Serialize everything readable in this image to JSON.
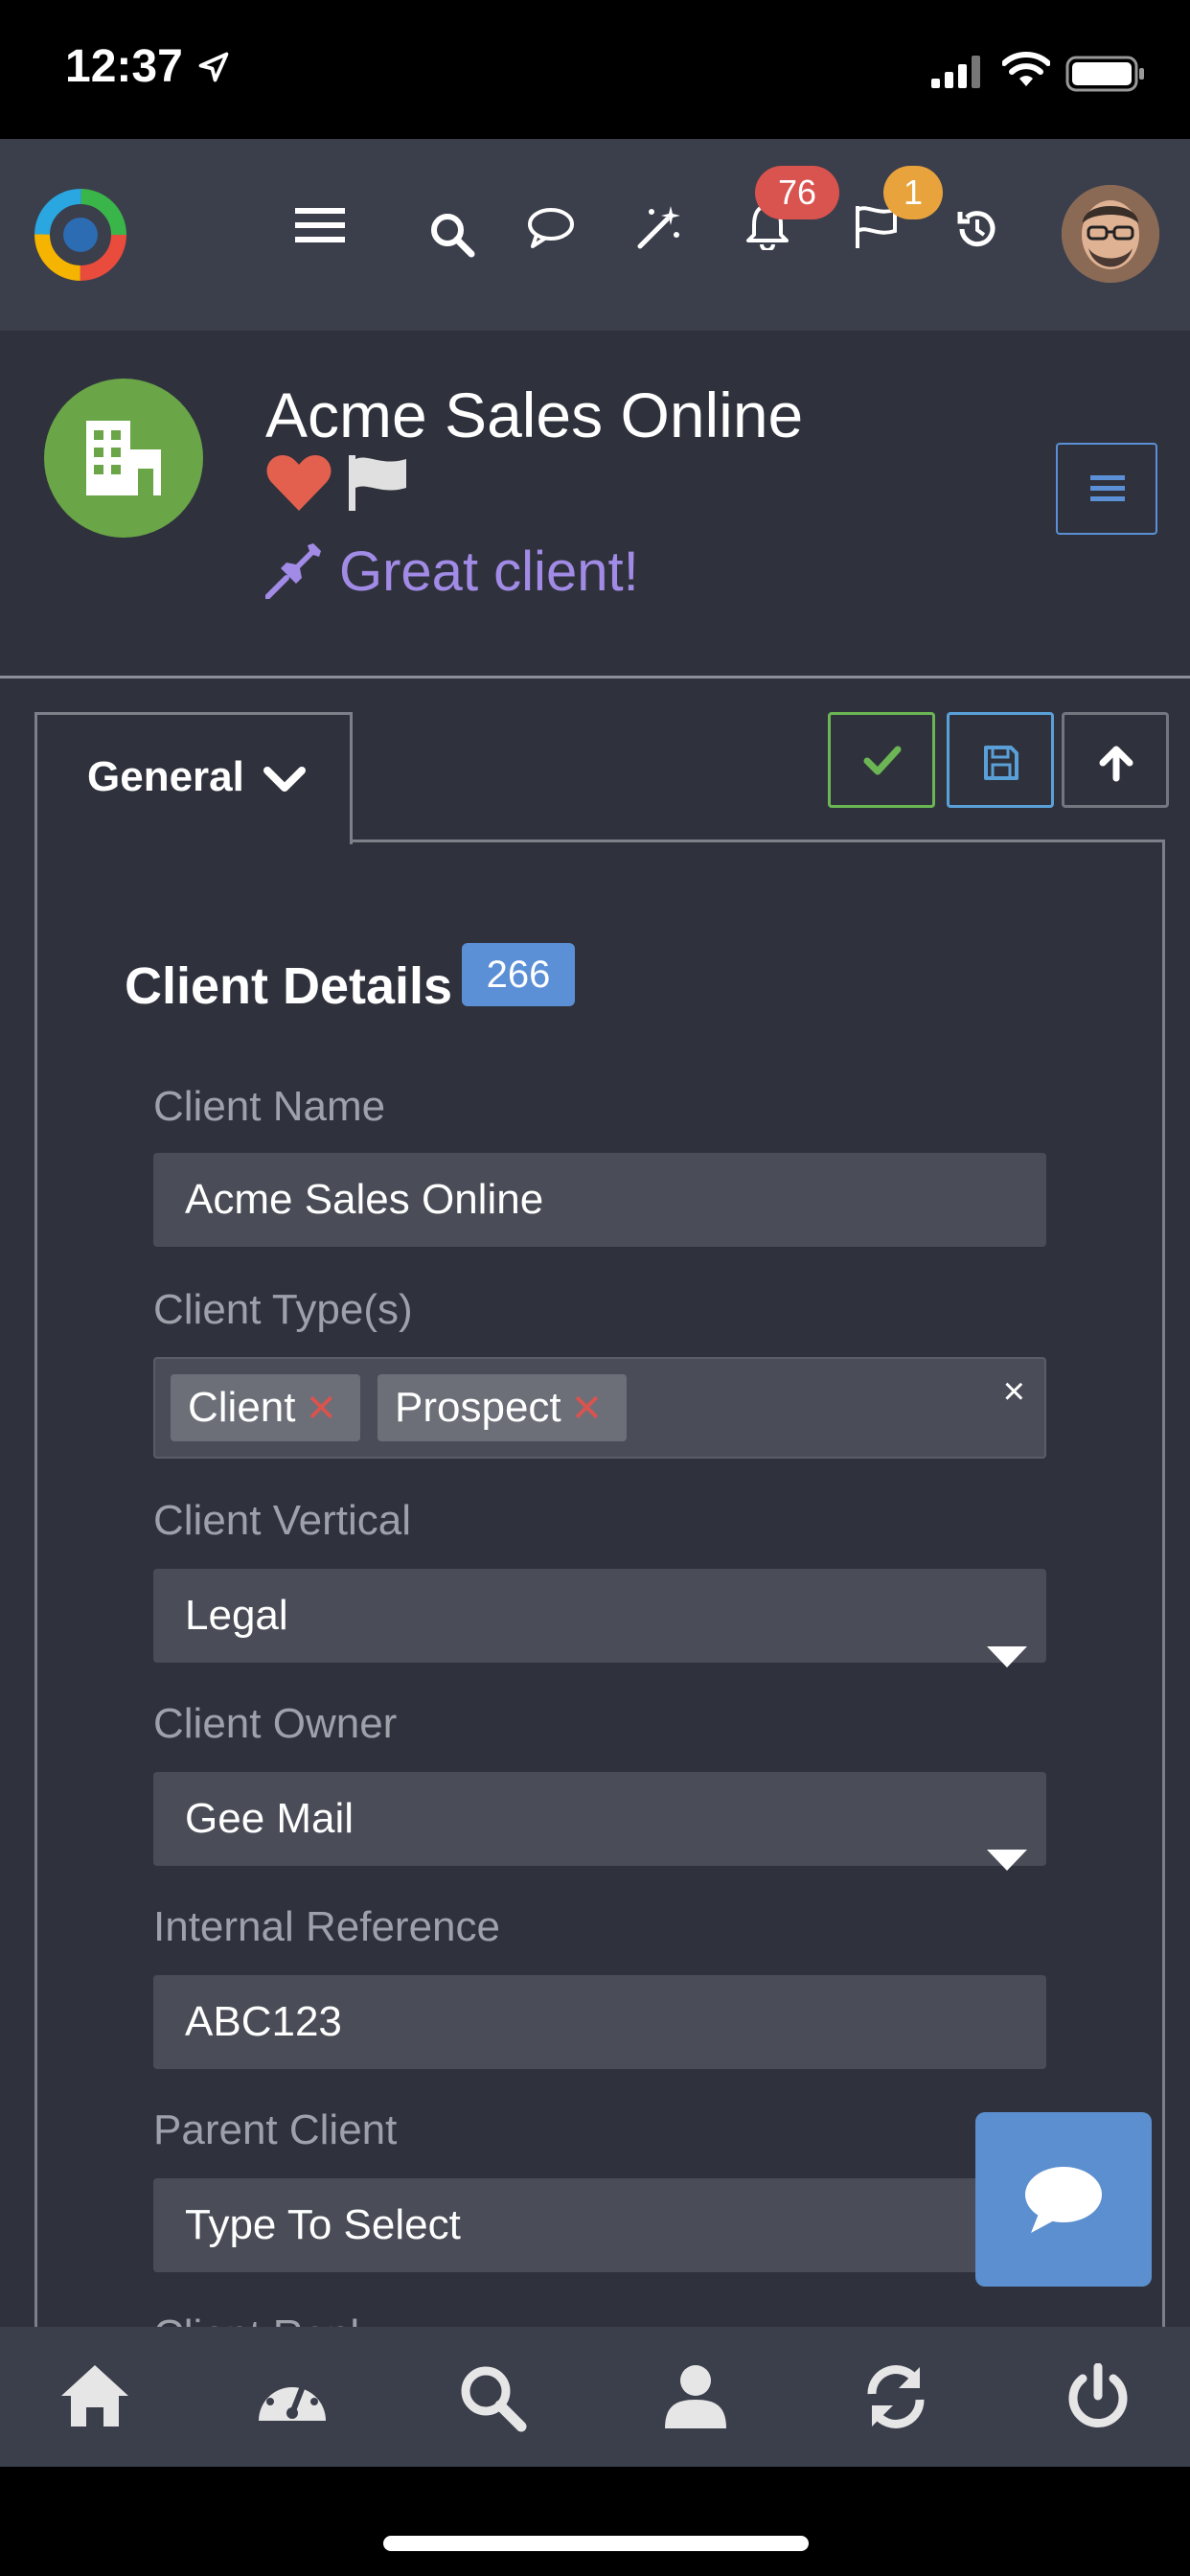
{
  "status_bar": {
    "time": "12:37"
  },
  "navbar": {
    "notifications_count": "76",
    "flags_count": "1"
  },
  "client": {
    "name": "Acme Sales Online",
    "pinned_note": "Great client!"
  },
  "tabs": {
    "active": "General"
  },
  "section": {
    "title": "Client Details",
    "count": "266"
  },
  "fields": {
    "client_name": {
      "label": "Client Name",
      "value": "Acme Sales Online"
    },
    "client_types": {
      "label": "Client Type(s)",
      "tags": [
        "Client",
        "Prospect"
      ]
    },
    "client_vertical": {
      "label": "Client Vertical",
      "value": "Legal"
    },
    "client_owner": {
      "label": "Client Owner",
      "value": "Gee Mail"
    },
    "internal_reference": {
      "label": "Internal Reference",
      "value": "ABC123"
    },
    "parent_client": {
      "label": "Parent Client",
      "placeholder": "Type To Select"
    },
    "next_label": "Client Rank"
  },
  "colors": {
    "background": "#2f323c",
    "navbar": "#3b3e4b",
    "accent_blue": "#5b8fd6",
    "success_green": "#6bb554",
    "danger_red": "#d9534f",
    "purple_note": "#a18be6"
  },
  "icons": {
    "navbar": [
      "app-logo-icon",
      "hamburger-menu-icon",
      "search-icon",
      "chat-bubble-icon",
      "magic-wand-icon",
      "bell-icon",
      "flag-icon",
      "history-icon"
    ],
    "bottom_nav": [
      "home-icon",
      "dashboard-gauge-icon",
      "search-icon",
      "user-icon",
      "refresh-icon",
      "power-icon"
    ]
  }
}
